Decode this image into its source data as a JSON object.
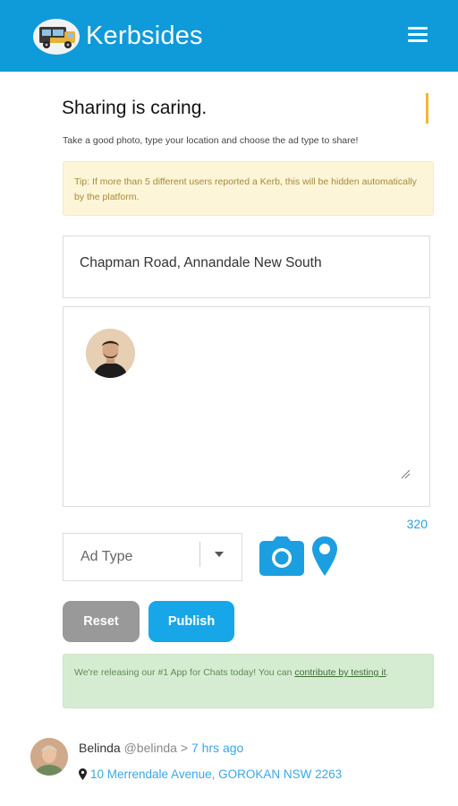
{
  "app": {
    "name": "Kerbsides",
    "logo_icon": "van-logo-icon",
    "menu_icon": "hamburger-menu-icon",
    "brand_color": "#0f9ad9"
  },
  "form": {
    "title": "Sharing is caring.",
    "subtitle": "Take a good photo, type your location and choose the ad type to share!",
    "tip": "Tip: If more than 5 different users reported a Kerb, this will be hidden automatically by the platform.",
    "location_value": "Chapman Road, Annandale  New South",
    "description_value": "",
    "char_counter": "320",
    "ad_type_placeholder": "Ad Type",
    "camera_icon": "camera-icon",
    "location_icon": "map-pin-icon",
    "reset_label": "Reset",
    "publish_label": "Publish"
  },
  "notice": {
    "text_before": "We're releasing our #1 App for Chats today! You can ",
    "link_text": "contribute by testing it",
    "text_after": "."
  },
  "feed": {
    "items": [
      {
        "name": "Belinda",
        "handle": "@belinda",
        "separator": ">",
        "time": "7 hrs ago",
        "address": "10 Merrendale Avenue, GOROKAN NSW 2263"
      }
    ]
  },
  "colors": {
    "accent_bar": "#f2b732",
    "publish": "#17a7e8",
    "reset": "#999999",
    "tip_bg": "#fdf5d8",
    "notice_bg": "#d6ecd2",
    "link": "#3aa7e3"
  }
}
